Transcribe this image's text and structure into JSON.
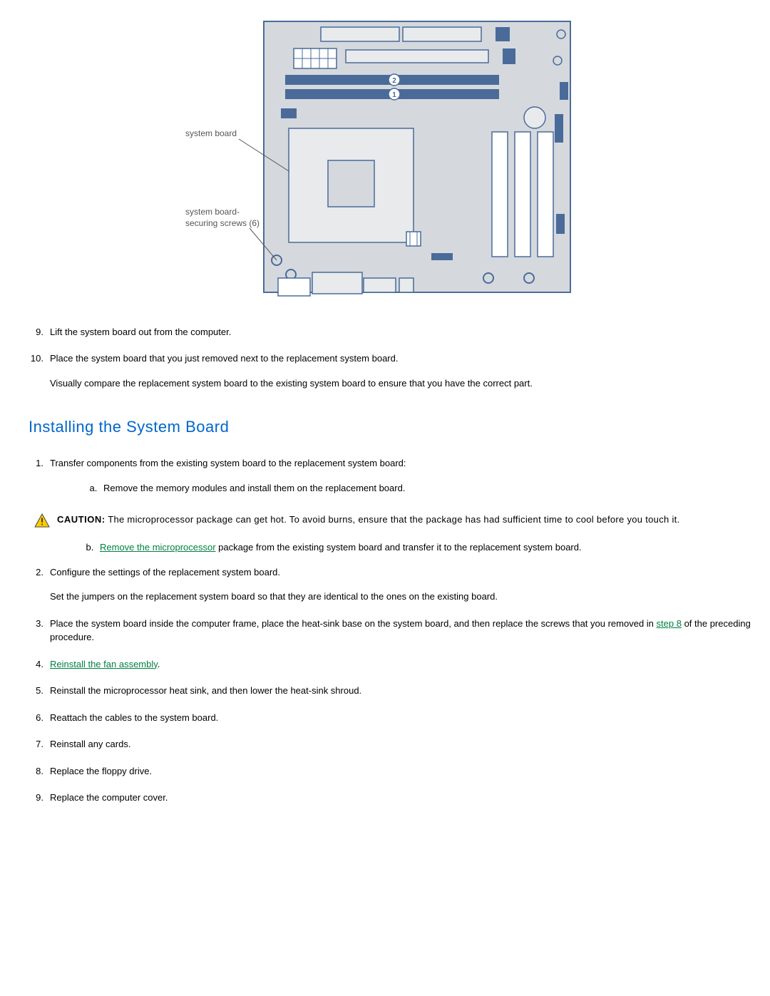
{
  "diagram": {
    "label_system_board": "system board",
    "label_screws": "system board-\nsecuring screws (6)"
  },
  "removal_steps": {
    "s9": "Lift the system board out from the computer.",
    "s10": "Place the system board that you just removed next to the replacement system board.",
    "s10_note": "Visually compare the replacement system board to the existing system board to ensure that you have the correct part."
  },
  "heading": "Installing the System Board",
  "install_steps": {
    "s1": "Transfer components from the existing system board to the replacement system board:",
    "s1a": "Remove the memory modules and install them on the replacement board.",
    "s1b_link": "Remove the microprocessor",
    "s1b_rest": " package from the existing system board and transfer it to the replacement system board.",
    "s2": "Configure the settings of the replacement system board.",
    "s2_note": "Set the jumpers on the replacement system board so that they are identical to the ones on the existing board.",
    "s3_a": "Place the system board inside the computer frame, place the heat-sink base on the system board, and then replace the screws that you removed in ",
    "s3_link": "step 8",
    "s3_b": " of the preceding procedure.",
    "s4_link": "Reinstall the fan assembly",
    "s4_b": ".",
    "s5": "Reinstall the microprocessor heat sink, and then lower the heat-sink shroud.",
    "s6": "Reattach the cables to the system board.",
    "s7": "Reinstall any cards.",
    "s8": "Replace the floppy drive.",
    "s9": "Replace the computer cover."
  },
  "caution": {
    "label": "CAUTION:",
    "text": " The microprocessor package can get hot. To avoid burns, ensure that the package has had sufficient time to cool before you touch it."
  }
}
